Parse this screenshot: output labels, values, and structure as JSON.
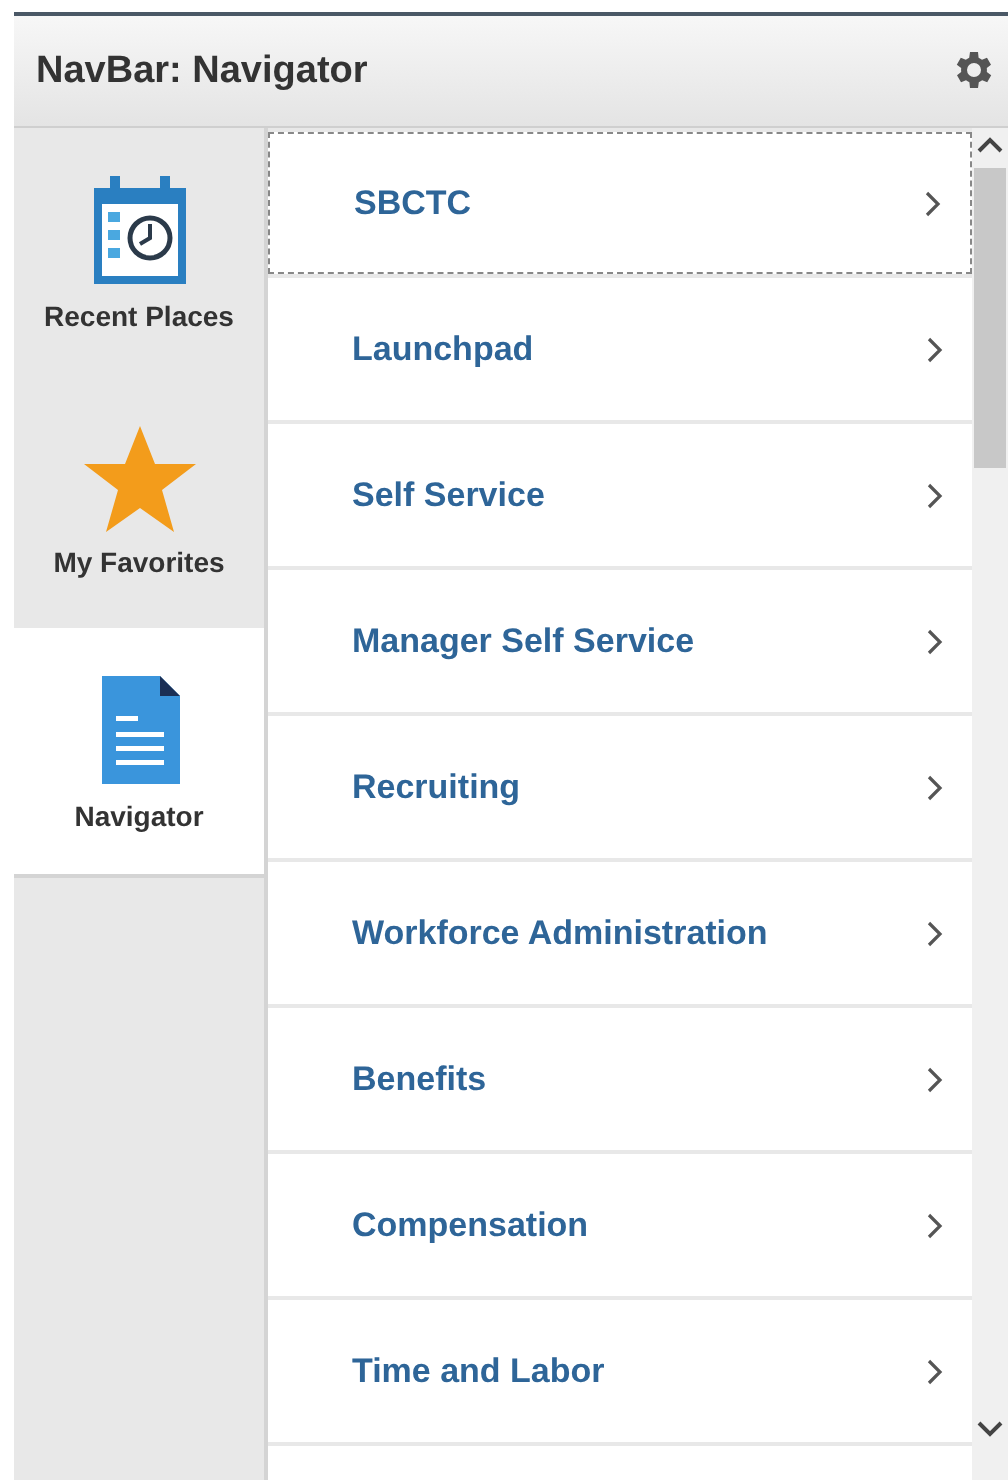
{
  "header": {
    "title": "NavBar: Navigator"
  },
  "tabs": [
    {
      "label": "Recent Places",
      "kind": "calendar",
      "selected": false
    },
    {
      "label": "My Favorites",
      "kind": "star",
      "selected": false
    },
    {
      "label": "Navigator",
      "kind": "document",
      "selected": true
    }
  ],
  "menu": [
    {
      "label": "SBCTC",
      "focused": true
    },
    {
      "label": "Launchpad",
      "focused": false
    },
    {
      "label": "Self Service",
      "focused": false
    },
    {
      "label": "Manager Self Service",
      "focused": false
    },
    {
      "label": "Recruiting",
      "focused": false
    },
    {
      "label": "Workforce Administration",
      "focused": false
    },
    {
      "label": "Benefits",
      "focused": false
    },
    {
      "label": "Compensation",
      "focused": false
    },
    {
      "label": "Time and Labor",
      "focused": false
    }
  ]
}
